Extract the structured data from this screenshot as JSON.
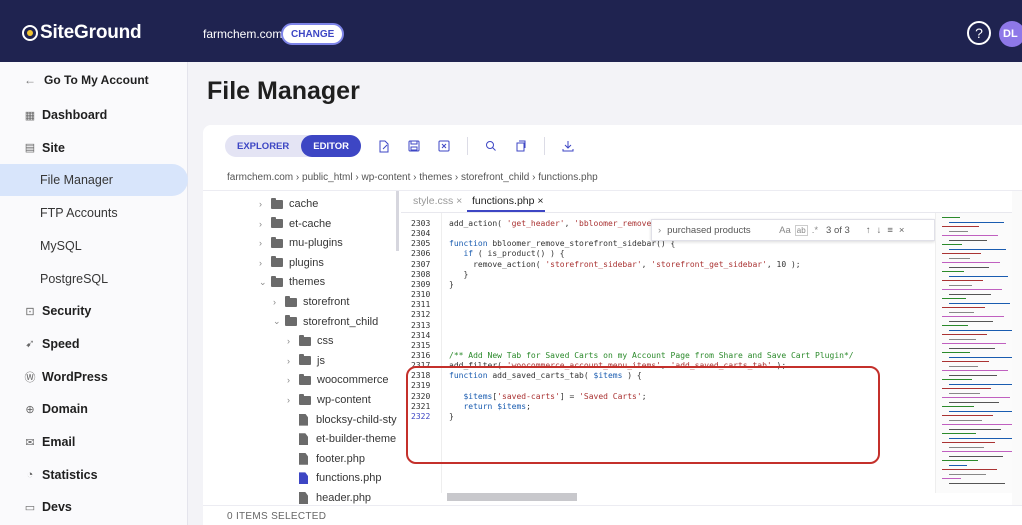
{
  "header": {
    "logo": "SiteGround",
    "site": "farmchem.com",
    "change_label": "CHANGE",
    "help_glyph": "?",
    "avatar_initials": "DL"
  },
  "sidebar": {
    "back_label": "Go To My Account",
    "items": [
      {
        "label": "Dashboard",
        "icon": "dashboard-icon"
      },
      {
        "label": "Site",
        "icon": "site-icon"
      },
      {
        "label": "File Manager",
        "sub": true,
        "active": true
      },
      {
        "label": "FTP Accounts",
        "sub": true
      },
      {
        "label": "MySQL",
        "sub": true
      },
      {
        "label": "PostgreSQL",
        "sub": true
      },
      {
        "label": "Security",
        "icon": "lock-icon"
      },
      {
        "label": "Speed",
        "icon": "rocket-icon"
      },
      {
        "label": "WordPress",
        "icon": "wordpress-icon"
      },
      {
        "label": "Domain",
        "icon": "globe-icon"
      },
      {
        "label": "Email",
        "icon": "mail-icon"
      },
      {
        "label": "Statistics",
        "icon": "chart-icon"
      },
      {
        "label": "Devs",
        "icon": "code-icon"
      }
    ]
  },
  "main": {
    "title": "File Manager",
    "toolbar": {
      "explorer": "EXPLORER",
      "editor": "EDITOR"
    },
    "breadcrumb": "farmchem.com › public_html › wp-content › themes › storefront_child › functions.php",
    "footer": "0 ITEMS SELECTED"
  },
  "tree": [
    {
      "name": "cache",
      "type": "folder",
      "depth": 0,
      "open": false
    },
    {
      "name": "et-cache",
      "type": "folder",
      "depth": 0,
      "open": false
    },
    {
      "name": "mu-plugins",
      "type": "folder",
      "depth": 0,
      "open": false
    },
    {
      "name": "plugins",
      "type": "folder",
      "depth": 0,
      "open": false
    },
    {
      "name": "themes",
      "type": "folder",
      "depth": 0,
      "open": true
    },
    {
      "name": "storefront",
      "type": "folder",
      "depth": 1,
      "open": false
    },
    {
      "name": "storefront_child",
      "type": "folder",
      "depth": 1,
      "open": true
    },
    {
      "name": "css",
      "type": "folder",
      "depth": 2,
      "open": false
    },
    {
      "name": "js",
      "type": "folder",
      "depth": 2,
      "open": false
    },
    {
      "name": "woocommerce",
      "type": "folder",
      "depth": 2,
      "open": false
    },
    {
      "name": "wp-content",
      "type": "folder",
      "depth": 2,
      "open": false
    },
    {
      "name": "blocksy-child-sty",
      "type": "file",
      "depth": 2
    },
    {
      "name": "et-builder-theme",
      "type": "file",
      "depth": 2
    },
    {
      "name": "footer.php",
      "type": "file",
      "depth": 2
    },
    {
      "name": "functions.php",
      "type": "file",
      "depth": 2,
      "active": true
    },
    {
      "name": "header.php",
      "type": "file",
      "depth": 2
    }
  ],
  "editor": {
    "tabs": [
      {
        "label": "style.css ×",
        "active": false
      },
      {
        "label": "functions.php ×",
        "active": true
      }
    ],
    "find": {
      "query": "purchased products",
      "count": "3 of 3",
      "case": "Aa",
      "word": "ab",
      "regex": ".*"
    },
    "lines": [
      {
        "n": "2303",
        "html": "add_action( <span class='st'>'get_header'</span>, <span class='st'>'bbloomer_remove_st</span>"
      },
      {
        "n": "2304",
        "html": ""
      },
      {
        "n": "2305",
        "html": "<span class='kw'>function</span> bbloomer_remove_storefront_sidebar() {"
      },
      {
        "n": "2306",
        "html": "   <span class='kw'>if</span> ( is_product() ) {"
      },
      {
        "n": "2307",
        "html": "     remove_action( <span class='st'>'storefront_sidebar'</span>, <span class='st'>'storefront_get_sidebar'</span>, 10 );"
      },
      {
        "n": "2308",
        "html": "   }"
      },
      {
        "n": "2309",
        "html": "}"
      },
      {
        "n": "2310",
        "html": ""
      },
      {
        "n": "2311",
        "html": ""
      },
      {
        "n": "2312",
        "html": ""
      },
      {
        "n": "2313",
        "html": ""
      },
      {
        "n": "2314",
        "html": ""
      },
      {
        "n": "2315",
        "html": ""
      },
      {
        "n": "2316",
        "html": "<span class='cm'>/** Add New Tab for Saved Carts on my Account Page from Share and Save Cart Plugin*/</span>"
      },
      {
        "n": "2317",
        "html": "add_filter( <span class='st'>'woocommerce_account_menu_items'</span>, <span class='st'>'add_saved_carts_tab'</span> );"
      },
      {
        "n": "2318",
        "html": "<span class='kw'>function</span> add_saved_carts_tab( <span class='kw'>$items</span> ) {"
      },
      {
        "n": "2319",
        "html": ""
      },
      {
        "n": "2320",
        "html": "   <span class='kw'>$items</span>[<span class='st'>'saved-carts'</span>] = <span class='st'>'Saved Carts'</span>;"
      },
      {
        "n": "2321",
        "html": "   <span class='kw'>return</span> <span class='kw'>$items</span>;"
      },
      {
        "n": "2322",
        "html": "}"
      }
    ]
  },
  "colors": {
    "brand_navy": "#1f2350",
    "accent": "#3d46c4",
    "highlight": "#c4302b",
    "active_side": "#d8e5fb"
  }
}
